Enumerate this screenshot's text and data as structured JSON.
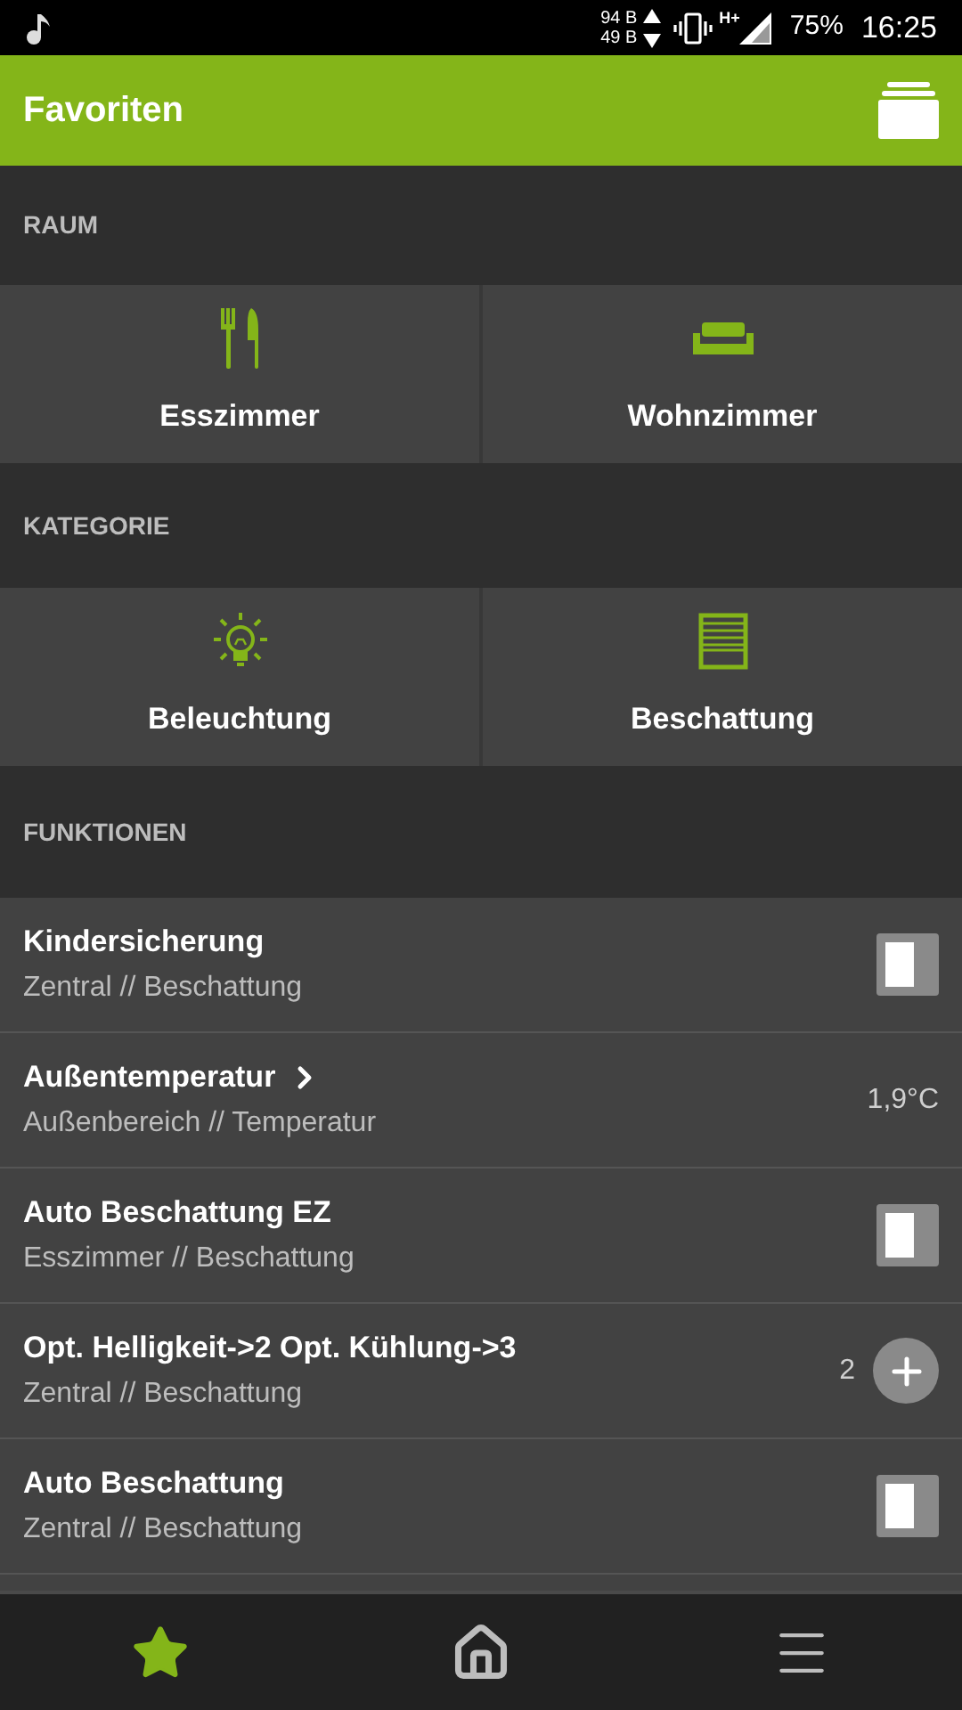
{
  "status_bar": {
    "rate_up": "94 B",
    "rate_down": "49 B",
    "network": "H+",
    "battery": "75%",
    "time": "16:25"
  },
  "app_bar": {
    "title": "Favoriten"
  },
  "sections": [
    {
      "title": "RAUM",
      "tiles": [
        {
          "label": "Esszimmer"
        },
        {
          "label": "Wohnzimmer"
        }
      ]
    },
    {
      "title": "KATEGORIE",
      "tiles": [
        {
          "label": "Beleuchtung"
        },
        {
          "label": "Beschattung"
        }
      ]
    }
  ],
  "functions": {
    "title": "FUNKTIONEN",
    "rows": [
      {
        "kind": "toggle",
        "name": "Kindersicherung",
        "location": "Zentral // Beschattung",
        "on": false
      },
      {
        "kind": "value",
        "name": "Außentemperatur",
        "location": "Außenbereich // Temperatur",
        "value": "1,9°C",
        "has_chevron": true
      },
      {
        "kind": "toggle",
        "name": "Auto Beschattung EZ",
        "location": "Esszimmer // Beschattung",
        "on": false
      },
      {
        "kind": "stepper",
        "name": "Opt. Helligkeit->2 Opt. Kühlung->3",
        "location": "Zentral // Beschattung",
        "value": "2"
      },
      {
        "kind": "toggle",
        "name": "Auto Beschattung",
        "location": "Zentral // Beschattung",
        "on": false
      }
    ]
  },
  "bottom_nav": [
    {
      "selected": true
    },
    {
      "selected": false
    },
    {
      "selected": false
    }
  ]
}
